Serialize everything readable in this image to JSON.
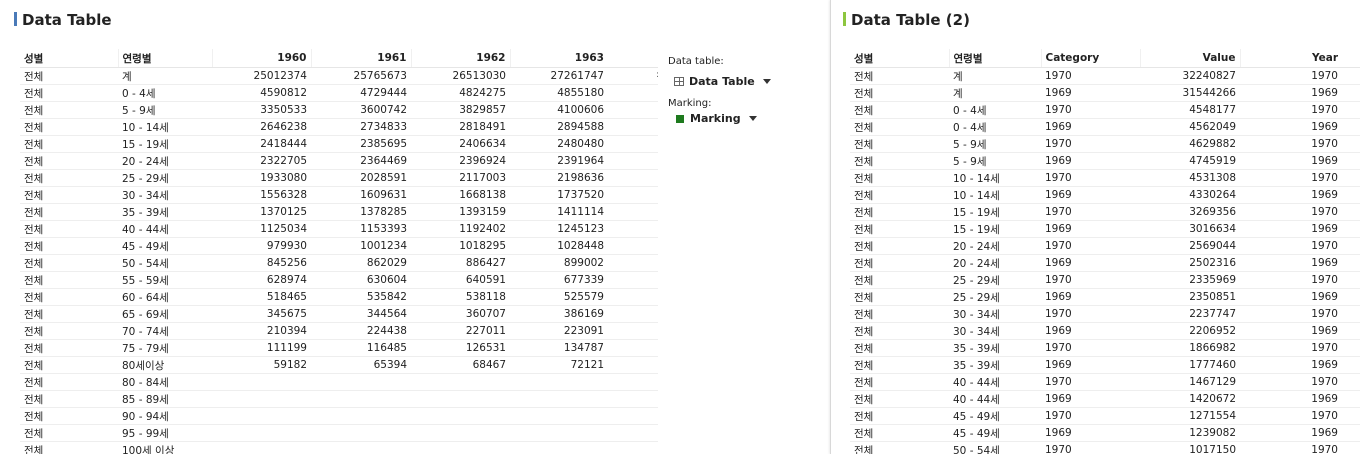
{
  "colors": {
    "left_accent": "#4a7ab8",
    "right_accent": "#8dc63f",
    "marking": "#1e7a1e"
  },
  "left": {
    "title": "Data Table",
    "columns": [
      "성별",
      "연령별",
      "1960",
      "1961",
      "1962",
      "1963"
    ],
    "rows": [
      [
        "전체",
        "계",
        "25012374",
        "25765673",
        "26513030",
        "27261747"
      ],
      [
        "전체",
        "0 - 4세",
        "4590812",
        "4729444",
        "4824275",
        "4855180"
      ],
      [
        "전체",
        "5 - 9세",
        "3350533",
        "3600742",
        "3829857",
        "4100606"
      ],
      [
        "전체",
        "10 - 14세",
        "2646238",
        "2734833",
        "2818491",
        "2894588"
      ],
      [
        "전체",
        "15 - 19세",
        "2418444",
        "2385695",
        "2406634",
        "2480480"
      ],
      [
        "전체",
        "20 - 24세",
        "2322705",
        "2364469",
        "2396924",
        "2391964"
      ],
      [
        "전체",
        "25 - 29세",
        "1933080",
        "2028591",
        "2117003",
        "2198636"
      ],
      [
        "전체",
        "30 - 34세",
        "1556328",
        "1609631",
        "1668138",
        "1737520"
      ],
      [
        "전체",
        "35 - 39세",
        "1370125",
        "1378285",
        "1393159",
        "1411114"
      ],
      [
        "전체",
        "40 - 44세",
        "1125034",
        "1153393",
        "1192402",
        "1245123"
      ],
      [
        "전체",
        "45 - 49세",
        "979930",
        "1001234",
        "1018295",
        "1028448"
      ],
      [
        "전체",
        "50 - 54세",
        "845256",
        "862029",
        "886427",
        "899002"
      ],
      [
        "전체",
        "55 - 59세",
        "628974",
        "630604",
        "640591",
        "677339"
      ],
      [
        "전체",
        "60 - 64세",
        "518465",
        "535842",
        "538118",
        "525579"
      ],
      [
        "전체",
        "65 - 69세",
        "345675",
        "344564",
        "360707",
        "386169"
      ],
      [
        "전체",
        "70 - 74세",
        "210394",
        "224438",
        "227011",
        "223091"
      ],
      [
        "전체",
        "75 - 79세",
        "111199",
        "116485",
        "126531",
        "134787"
      ],
      [
        "전체",
        "80세이상",
        "59182",
        "65394",
        "68467",
        "72121"
      ],
      [
        "전체",
        "80 - 84세",
        "",
        "",
        "",
        ""
      ],
      [
        "전체",
        "85 - 89세",
        "",
        "",
        "",
        ""
      ],
      [
        "전체",
        "90 - 94세",
        "",
        "",
        "",
        ""
      ],
      [
        "전체",
        "95 - 99세",
        "",
        "",
        "",
        ""
      ],
      [
        "전체",
        "100세 이상",
        "",
        "",
        "",
        ""
      ]
    ]
  },
  "side": {
    "data_table_label": "Data table:",
    "data_table_value": "Data Table",
    "marking_label": "Marking:",
    "marking_value": "Marking",
    "overflow_mark": ":"
  },
  "right": {
    "title": "Data Table (2)",
    "columns": [
      "성별",
      "연령별",
      "Category",
      "Value",
      "Year"
    ],
    "rows": [
      [
        "전체",
        "계",
        "1970",
        "32240827",
        "1970"
      ],
      [
        "전체",
        "계",
        "1969",
        "31544266",
        "1969"
      ],
      [
        "전체",
        "0 - 4세",
        "1970",
        "4548177",
        "1970"
      ],
      [
        "전체",
        "0 - 4세",
        "1969",
        "4562049",
        "1969"
      ],
      [
        "전체",
        "5 - 9세",
        "1970",
        "4629882",
        "1970"
      ],
      [
        "전체",
        "5 - 9세",
        "1969",
        "4745919",
        "1969"
      ],
      [
        "전체",
        "10 - 14세",
        "1970",
        "4531308",
        "1970"
      ],
      [
        "전체",
        "10 - 14세",
        "1969",
        "4330264",
        "1969"
      ],
      [
        "전체",
        "15 - 19세",
        "1970",
        "3269356",
        "1970"
      ],
      [
        "전체",
        "15 - 19세",
        "1969",
        "3016634",
        "1969"
      ],
      [
        "전체",
        "20 - 24세",
        "1970",
        "2569044",
        "1970"
      ],
      [
        "전체",
        "20 - 24세",
        "1969",
        "2502316",
        "1969"
      ],
      [
        "전체",
        "25 - 29세",
        "1970",
        "2335969",
        "1970"
      ],
      [
        "전체",
        "25 - 29세",
        "1969",
        "2350851",
        "1969"
      ],
      [
        "전체",
        "30 - 34세",
        "1970",
        "2237747",
        "1970"
      ],
      [
        "전체",
        "30 - 34세",
        "1969",
        "2206952",
        "1969"
      ],
      [
        "전체",
        "35 - 39세",
        "1970",
        "1866982",
        "1970"
      ],
      [
        "전체",
        "35 - 39세",
        "1969",
        "1777460",
        "1969"
      ],
      [
        "전체",
        "40 - 44세",
        "1970",
        "1467129",
        "1970"
      ],
      [
        "전체",
        "40 - 44세",
        "1969",
        "1420672",
        "1969"
      ],
      [
        "전체",
        "45 - 49세",
        "1970",
        "1271554",
        "1970"
      ],
      [
        "전체",
        "45 - 49세",
        "1969",
        "1239082",
        "1969"
      ],
      [
        "전체",
        "50 - 54세",
        "1970",
        "1017150",
        "1970"
      ]
    ]
  }
}
